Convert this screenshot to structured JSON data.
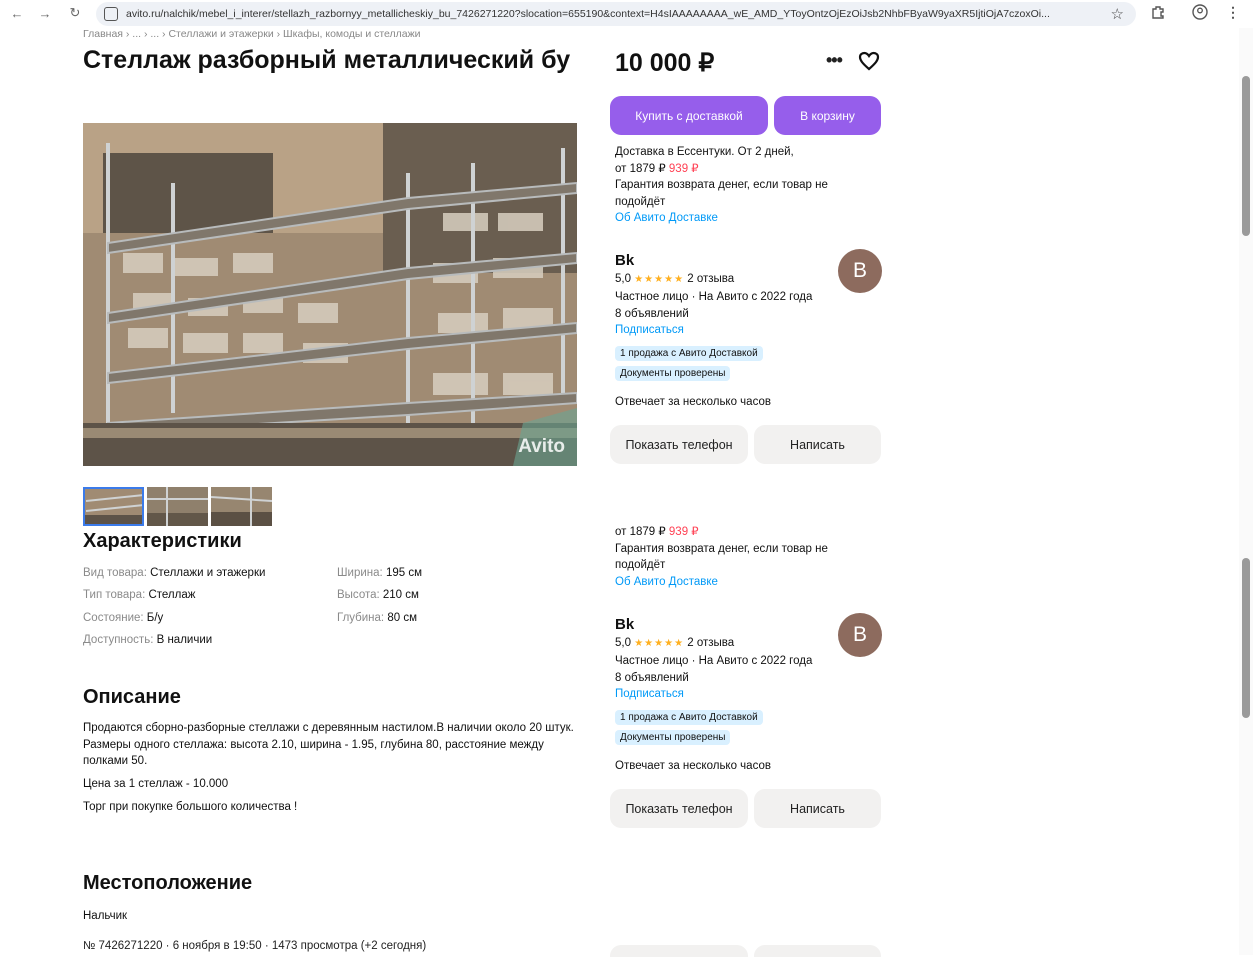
{
  "browser": {
    "url": "avito.ru/nalchik/mebel_i_interer/stellazh_razbornyy_metallicheskiy_bu_7426271220?slocation=655190&context=H4sIAAAAAAAA_wE_AMD_YToyOntzOjEzOiJsb2NhbFByaW9yaXR5IjtiOjA7czoxOi..."
  },
  "breadcrumb": "Главная › ... › ... › Стеллажи и этажерки › Шкафы, комоды и стеллажи",
  "listing": {
    "title": "Стеллаж разборный металлический бу",
    "price": "10 000 ₽",
    "watermark": "Avito"
  },
  "buttons": {
    "buy_delivery": "Купить с доставкой",
    "to_cart": "В корзину",
    "show_phone": "Показать телефон",
    "write": "Написать"
  },
  "delivery": {
    "line1": "Доставка в Ессентуки. От 2 дней,",
    "price_prefix": "от 1879 ₽",
    "price_discount": "939 ₽",
    "guarantee": "Гарантия возврата денег, если товар не подойдёт",
    "link": "Об Авито Доставке"
  },
  "seller": {
    "name": "Bk",
    "avatar_letter": "B",
    "rating": "5,0",
    "stars": "★★★★★",
    "reviews": "2 отзыва",
    "info": "Частное лицо · На Авито с 2022 года",
    "listings": "8 объявлений",
    "subscribe": "Подписаться",
    "badge1": "1 продажа с Авито Доставкой",
    "badge2": "Документы проверены",
    "response": "Отвечает за несколько часов"
  },
  "specs": {
    "heading": "Характеристики",
    "items": [
      {
        "k": "Вид товара:",
        "v": "Стеллажи и этажерки"
      },
      {
        "k": "Тип товара:",
        "v": "Стеллаж"
      },
      {
        "k": "Состояние:",
        "v": "Б/у"
      },
      {
        "k": "Доступность:",
        "v": "В наличии"
      },
      {
        "k": "Ширина:",
        "v": "195 см"
      },
      {
        "k": "Высота:",
        "v": "210 см"
      },
      {
        "k": "Глубина:",
        "v": "80 см"
      }
    ]
  },
  "description": {
    "heading": "Описание",
    "p1": "Продаются сборно-разборные стеллажи с деревянным настилом.В наличии около 20 штук.",
    "p2": "Размеры одного стеллажа: высота 2.10, ширина - 1.95, глубина 80, расстояние между полками 50.",
    "p3": "Цена за 1 стеллаж - 10.000",
    "p4": "Торг при покупке большого количества !"
  },
  "location": {
    "heading": "Местоположение",
    "city": "Нальчик"
  },
  "meta": "№ 7426271220 · 6 ноября в 19:50 · 1473 просмотра (+2 сегодня)",
  "icons": {
    "back": "←",
    "forward": "→",
    "reload": "↻",
    "star": "☆",
    "more": "•••"
  }
}
